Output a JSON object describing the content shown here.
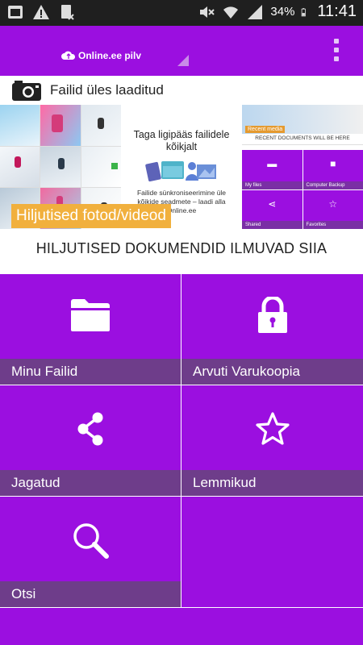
{
  "status_bar": {
    "battery": "34%",
    "time": "11:41",
    "icons": [
      "notification-icon",
      "warning-icon",
      "sim-icon",
      "mute-icon",
      "wifi-icon",
      "signal-icon",
      "battery-icon"
    ]
  },
  "app_bar": {
    "brand": "Online.ee pilv",
    "brand_icon": "cloud-icon",
    "menu_icon": "overflow-menu-icon",
    "accent_color": "#9b0fe0"
  },
  "upload": {
    "icon": "camera-icon",
    "label": "Failid üles laaditud"
  },
  "carousel": {
    "promo_title": "Taga ligipääs failidele kõikjalt",
    "promo_text": "Failide sünkroniseerimine üle kõikide seadmete – laadi alla Online.ee",
    "preview": {
      "recent_media": "Recent media",
      "recent_documents": "RECENT DOCUMENTS WILL BE HERE",
      "cells": [
        "My files",
        "Computer Backup",
        "Shared",
        "Favorites"
      ]
    },
    "badge": "Hiljutised fotod/videod"
  },
  "documents_heading": "HILJUTISED DOKUMENDID ILMUVAD SIIA",
  "tiles": [
    {
      "label": "Minu Failid",
      "icon": "folder-icon"
    },
    {
      "label": "Arvuti Varukoopia",
      "icon": "lock-icon"
    },
    {
      "label": "Jagatud",
      "icon": "share-icon"
    },
    {
      "label": "Lemmikud",
      "icon": "star-icon"
    },
    {
      "label": "Otsi",
      "icon": "search-icon"
    }
  ]
}
